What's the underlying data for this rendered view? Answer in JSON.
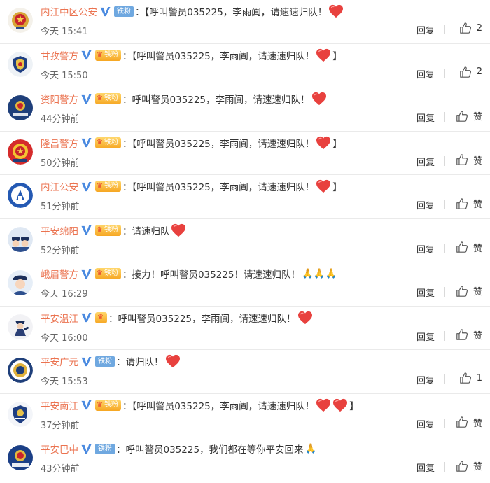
{
  "colors": {
    "username": "#eb7350",
    "verify": "#4a8ae0",
    "heart": "#e8413e",
    "fan_badge": "#6fa8e0"
  },
  "comments": [
    {
      "user": "内江中区公安",
      "badge": "铁粉",
      "badge_style": "blue",
      "prefix": "：【呼叫警员035225，李雨阗，请速速归队！",
      "suffix": "",
      "hearts": 1,
      "time": "今天 15:41",
      "reply": "回复",
      "like": "2",
      "avatar": "police-emblem"
    },
    {
      "user": "甘孜警方",
      "badge": "铁粉",
      "badge_style": "gold",
      "prefix": "：【呼叫警员035225，李雨阗，请速速归队！",
      "suffix": "】",
      "hearts": 1,
      "time": "今天 15:50",
      "reply": "回复",
      "like": "2",
      "avatar": "badge-shield"
    },
    {
      "user": "资阳警方",
      "badge": "铁粉",
      "badge_style": "gold",
      "prefix": "：呼叫警员035225，李雨阗，请速速归队！",
      "suffix": "",
      "hearts": 1,
      "time": "44分钟前",
      "reply": "回复",
      "like": "赞",
      "avatar": "blue-square"
    },
    {
      "user": "隆昌警方",
      "badge": "铁粉",
      "badge_style": "gold",
      "prefix": "：【呼叫警员035225，李雨阗，请速速归队！",
      "suffix": "】",
      "hearts": 1,
      "time": "50分钟前",
      "reply": "回复",
      "like": "赞",
      "avatar": "red-emblem"
    },
    {
      "user": "内江公安",
      "badge": "铁粉",
      "badge_style": "gold",
      "prefix": "：【呼叫警员035225，李雨阗，请速速归队！",
      "suffix": "】",
      "hearts": 1,
      "time": "51分钟前",
      "reply": "回复",
      "like": "赞",
      "avatar": "blue-circle"
    },
    {
      "user": "平安绵阳",
      "badge": "铁粉",
      "badge_style": "gold",
      "prefix": "：请速归队",
      "suffix": "",
      "hearts": 1,
      "time": "52分钟前",
      "reply": "回复",
      "like": "赞",
      "avatar": "cartoon-police"
    },
    {
      "user": "峨眉警方",
      "badge": "铁粉",
      "badge_style": "gold",
      "prefix": "：接力！呼叫警员035225！请速速归队！",
      "suffix": "🙏🙏🙏",
      "hearts": 0,
      "time": "今天 16:29",
      "reply": "回复",
      "like": "赞",
      "avatar": "police-girl"
    },
    {
      "user": "平安温江",
      "badge": "",
      "badge_style": "crown",
      "prefix": "：呼叫警员035225，李雨阗，请速速归队！",
      "suffix": "",
      "hearts": 1,
      "time": "今天 16:00",
      "reply": "回复",
      "like": "赞",
      "avatar": "police-figure"
    },
    {
      "user": "平安广元",
      "badge": "铁粉",
      "badge_style": "blue",
      "prefix": "：请归队！",
      "suffix": "",
      "hearts": 1,
      "time": "今天 15:53",
      "reply": "回复",
      "like": "1",
      "avatar": "round-seal"
    },
    {
      "user": "平安南江",
      "badge": "铁粉",
      "badge_style": "gold",
      "prefix": "：【呼叫警员035225，李雨阗，请速速归队！",
      "suffix": "】",
      "hearts": 2,
      "time": "37分钟前",
      "reply": "回复",
      "like": "赞",
      "avatar": "shield-logo"
    },
    {
      "user": "平安巴中",
      "badge": "铁粉",
      "badge_style": "blue",
      "prefix": "：呼叫警员035225，我们都在等你平安回来",
      "suffix": "🙏",
      "hearts": 0,
      "time": "43分钟前",
      "reply": "回复",
      "like": "赞",
      "avatar": "blue-emblem"
    }
  ]
}
